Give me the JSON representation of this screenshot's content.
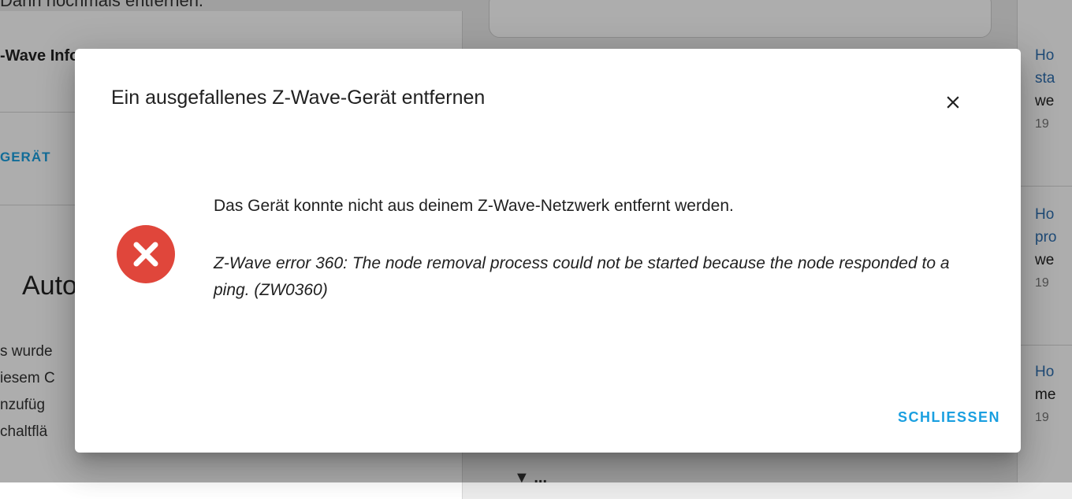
{
  "background": {
    "top_text": "Dann nochmals entfernen.",
    "left_card": {
      "title_fragment": "-Wave Info",
      "close_glyph": "✕",
      "button_fragment": "GERÄT",
      "heading_fragment": "Autor",
      "paragraph_lines": [
        "s wurde",
        "iesem C",
        "nzufüg",
        "chaltflä"
      ]
    },
    "mid_bottom_text": "▼ ...",
    "right_news": [
      {
        "title": "Ho",
        "text_a": "sta",
        "text_b": "we",
        "date": "19"
      },
      {
        "title": "Ho",
        "text_a": "pro",
        "text_b": "we",
        "date": "19"
      },
      {
        "title": "Ho",
        "text_a": "",
        "text_b": "me",
        "date": "19"
      }
    ]
  },
  "dialog": {
    "title": "Ein ausgefallenes Z-Wave-Gerät entfernen",
    "message": "Das Gerät konnte nicht aus deinem Z-Wave-Netzwerk entfernt werden.",
    "error_detail": "Z-Wave error 360: The node removal process could not be started because the node responded to a ping. (ZW0360)",
    "close_button_label": "SCHLIESSEN",
    "icons": {
      "close": "close-icon",
      "error": "error-circle-icon"
    },
    "colors": {
      "error": "#e0463b",
      "accent": "#1a9fe0"
    }
  }
}
